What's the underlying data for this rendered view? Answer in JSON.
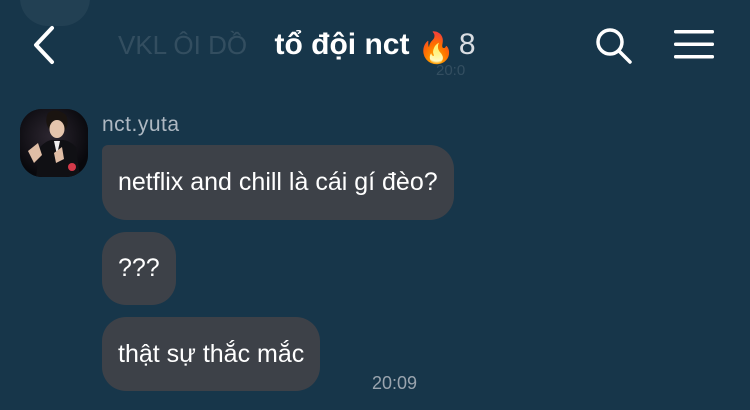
{
  "header": {
    "title": "tổ đội nct",
    "title_emoji": "🔥",
    "member_count": "8",
    "icons": {
      "back": "chevron-left-icon",
      "search": "search-icon",
      "menu": "hamburger-menu-icon"
    }
  },
  "previous_message": {
    "text": "VKL ÔI DỒ",
    "time": "20:0"
  },
  "messages": {
    "sender_name": "nct.yuta",
    "items": [
      {
        "text": "netflix and chill là cái gí đèo?"
      },
      {
        "text": "???"
      },
      {
        "text": "thật sự thắc mắc"
      }
    ],
    "last_time": "20:09"
  },
  "colors": {
    "background": "#17364a",
    "bubble": "#3d4148",
    "text": "#ffffff",
    "muted": "#aeb8c2"
  }
}
